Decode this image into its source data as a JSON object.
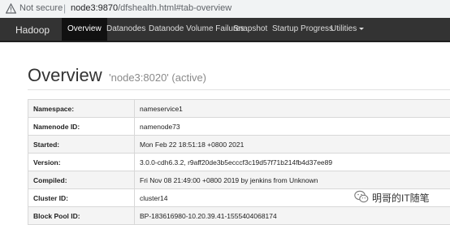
{
  "browser": {
    "security_label": "Not secure",
    "url_host": "node3:9870",
    "url_path": "/dfshealth.html#tab-overview"
  },
  "navbar": {
    "brand": "Hadoop",
    "items": [
      {
        "label": "Overview",
        "active": true
      },
      {
        "label": "Datanodes"
      },
      {
        "label": "Datanode Volume Failures"
      },
      {
        "label": "Snapshot"
      },
      {
        "label": "Startup Progress"
      },
      {
        "label": "Utilities",
        "dropdown": true
      }
    ],
    "background": "#333333"
  },
  "overview": {
    "title": "Overview",
    "subtitle": "'node3:8020' (active)"
  },
  "info_table": {
    "rows": [
      {
        "key": "Namespace:",
        "value": "nameservice1"
      },
      {
        "key": "Namenode ID:",
        "value": "namenode73"
      },
      {
        "key": "Started:",
        "value": "Mon Feb 22 18:51:18 +0800 2021"
      },
      {
        "key": "Version:",
        "value": "3.0.0-cdh6.3.2, r9aff20de3b5ecccf3c19d57f71b214fb4d37ee89"
      },
      {
        "key": "Compiled:",
        "value": "Fri Nov 08 21:49:00 +0800 2019 by jenkins from Unknown"
      },
      {
        "key": "Cluster ID:",
        "value": "cluster14"
      },
      {
        "key": "Block Pool ID:",
        "value": "BP-183616980-10.20.39.41-1555404068174"
      }
    ]
  },
  "watermark": {
    "text": "明哥的IT随笔",
    "icon": "wechat-icon"
  }
}
